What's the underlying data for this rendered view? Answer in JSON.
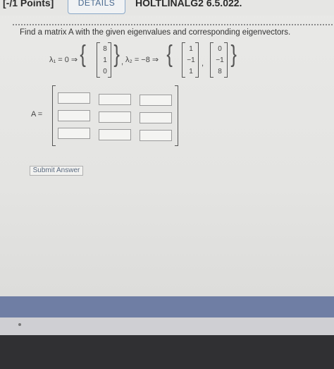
{
  "header": {
    "points": "[-/1 Points]",
    "details_label": "DETAILS",
    "course_code": "HOLTLINALG2 6.5.022."
  },
  "question": {
    "prompt": "Find a matrix A with the given eigenvalues and corresponding eigenvectors.",
    "lambda1_label": "λ₁ = 0 ⇒",
    "lambda2_label": "λ₂ = −8 ⇒",
    "comma": ",",
    "eigenvector1": [
      "8",
      "1",
      "0"
    ],
    "eigenvector2": [
      "1",
      "−1",
      "1"
    ],
    "eigenvector3": [
      "0",
      "−1",
      "8"
    ],
    "matrix_label": "A ="
  },
  "answer_matrix": {
    "cells": [
      "",
      "",
      "",
      "",
      "",
      "",
      "",
      "",
      ""
    ]
  },
  "actions": {
    "submit_label": "Submit Answer"
  }
}
